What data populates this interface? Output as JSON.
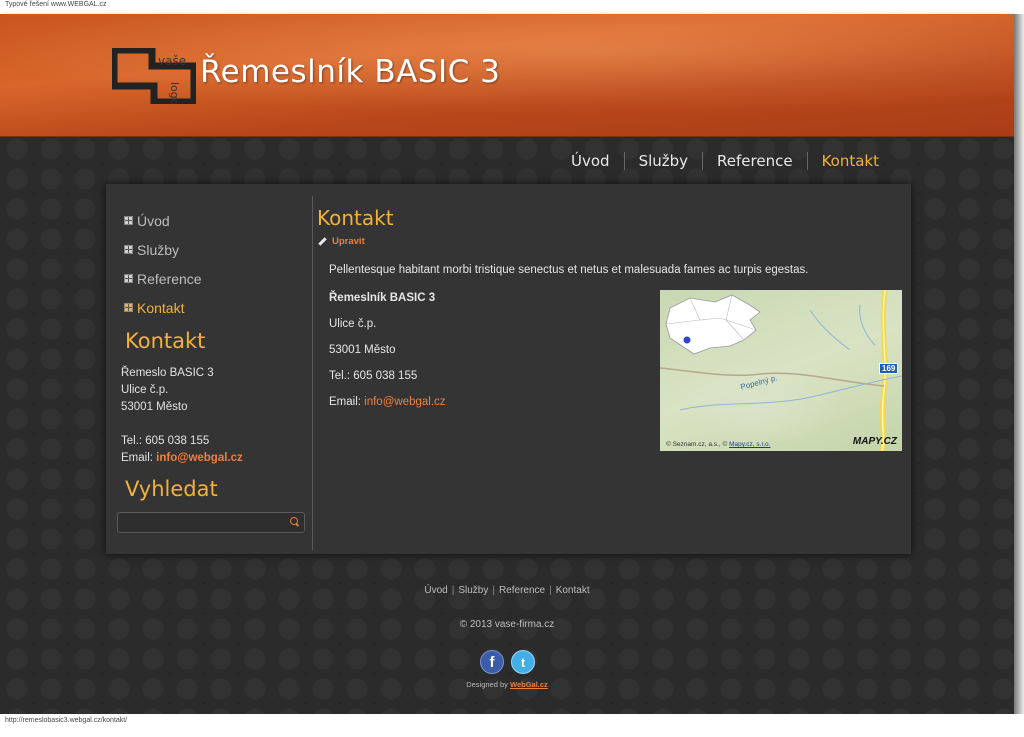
{
  "browser": {
    "top_label": "Typové řešení www.WEBGAL.cz",
    "status_url": "http://remeslobasic3.webgal.cz/kontakt/"
  },
  "header": {
    "title": "Řemeslník BASIC 3",
    "logo_text": "vaše logo"
  },
  "nav": {
    "items": [
      {
        "label": "Úvod",
        "active": false
      },
      {
        "label": "Služby",
        "active": false
      },
      {
        "label": "Reference",
        "active": false
      },
      {
        "label": "Kontakt",
        "active": true
      }
    ]
  },
  "sidebar": {
    "menu": [
      {
        "label": "Úvod",
        "active": false
      },
      {
        "label": "Služby",
        "active": false
      },
      {
        "label": "Reference",
        "active": false
      },
      {
        "label": "Kontakt",
        "active": true
      }
    ],
    "contact_heading": "Kontakt",
    "contact_name": "Řemeslo BASIC 3",
    "contact_street": "Ulice č.p.",
    "contact_city": "53001 Město",
    "contact_tel": "Tel.: 605 038 155",
    "contact_email_label": "Email:",
    "contact_email": "info@webgal.cz",
    "search_heading": "Vyhledat",
    "search_placeholder": ""
  },
  "main": {
    "heading": "Kontakt",
    "edit_label": "Upravit",
    "intro": "Pellentesque habitant morbi tristique senectus et netus et malesuada fames ac turpis egestas.",
    "company": "Řemeslník BASIC 3",
    "street": "Ulice č.p.",
    "city": "53001 Město",
    "tel": "Tel.: 605 038 155",
    "email_label": "Email:",
    "email": "info@webgal.cz"
  },
  "map": {
    "copyright_prefix": "© Seznam.cz, a.s., ©",
    "copyright_link": "Mapy.cz, s.r.o.",
    "logo_part1": "MAPY",
    "logo_part2": ".CZ",
    "road_number": "169",
    "river_name": "Popelný p."
  },
  "footer": {
    "nav": [
      "Úvod",
      "Služby",
      "Reference",
      "Kontakt"
    ],
    "copyright": "© 2013 vase-firma.cz",
    "designed_prefix": "Designed by",
    "designed_link": "WebGal.cz",
    "facebook_glyph": "f",
    "twitter_glyph": "t"
  },
  "colors": {
    "accent": "#f2b13c",
    "link": "#f07f3e",
    "header": "#c9561c",
    "panel": "#343434"
  }
}
